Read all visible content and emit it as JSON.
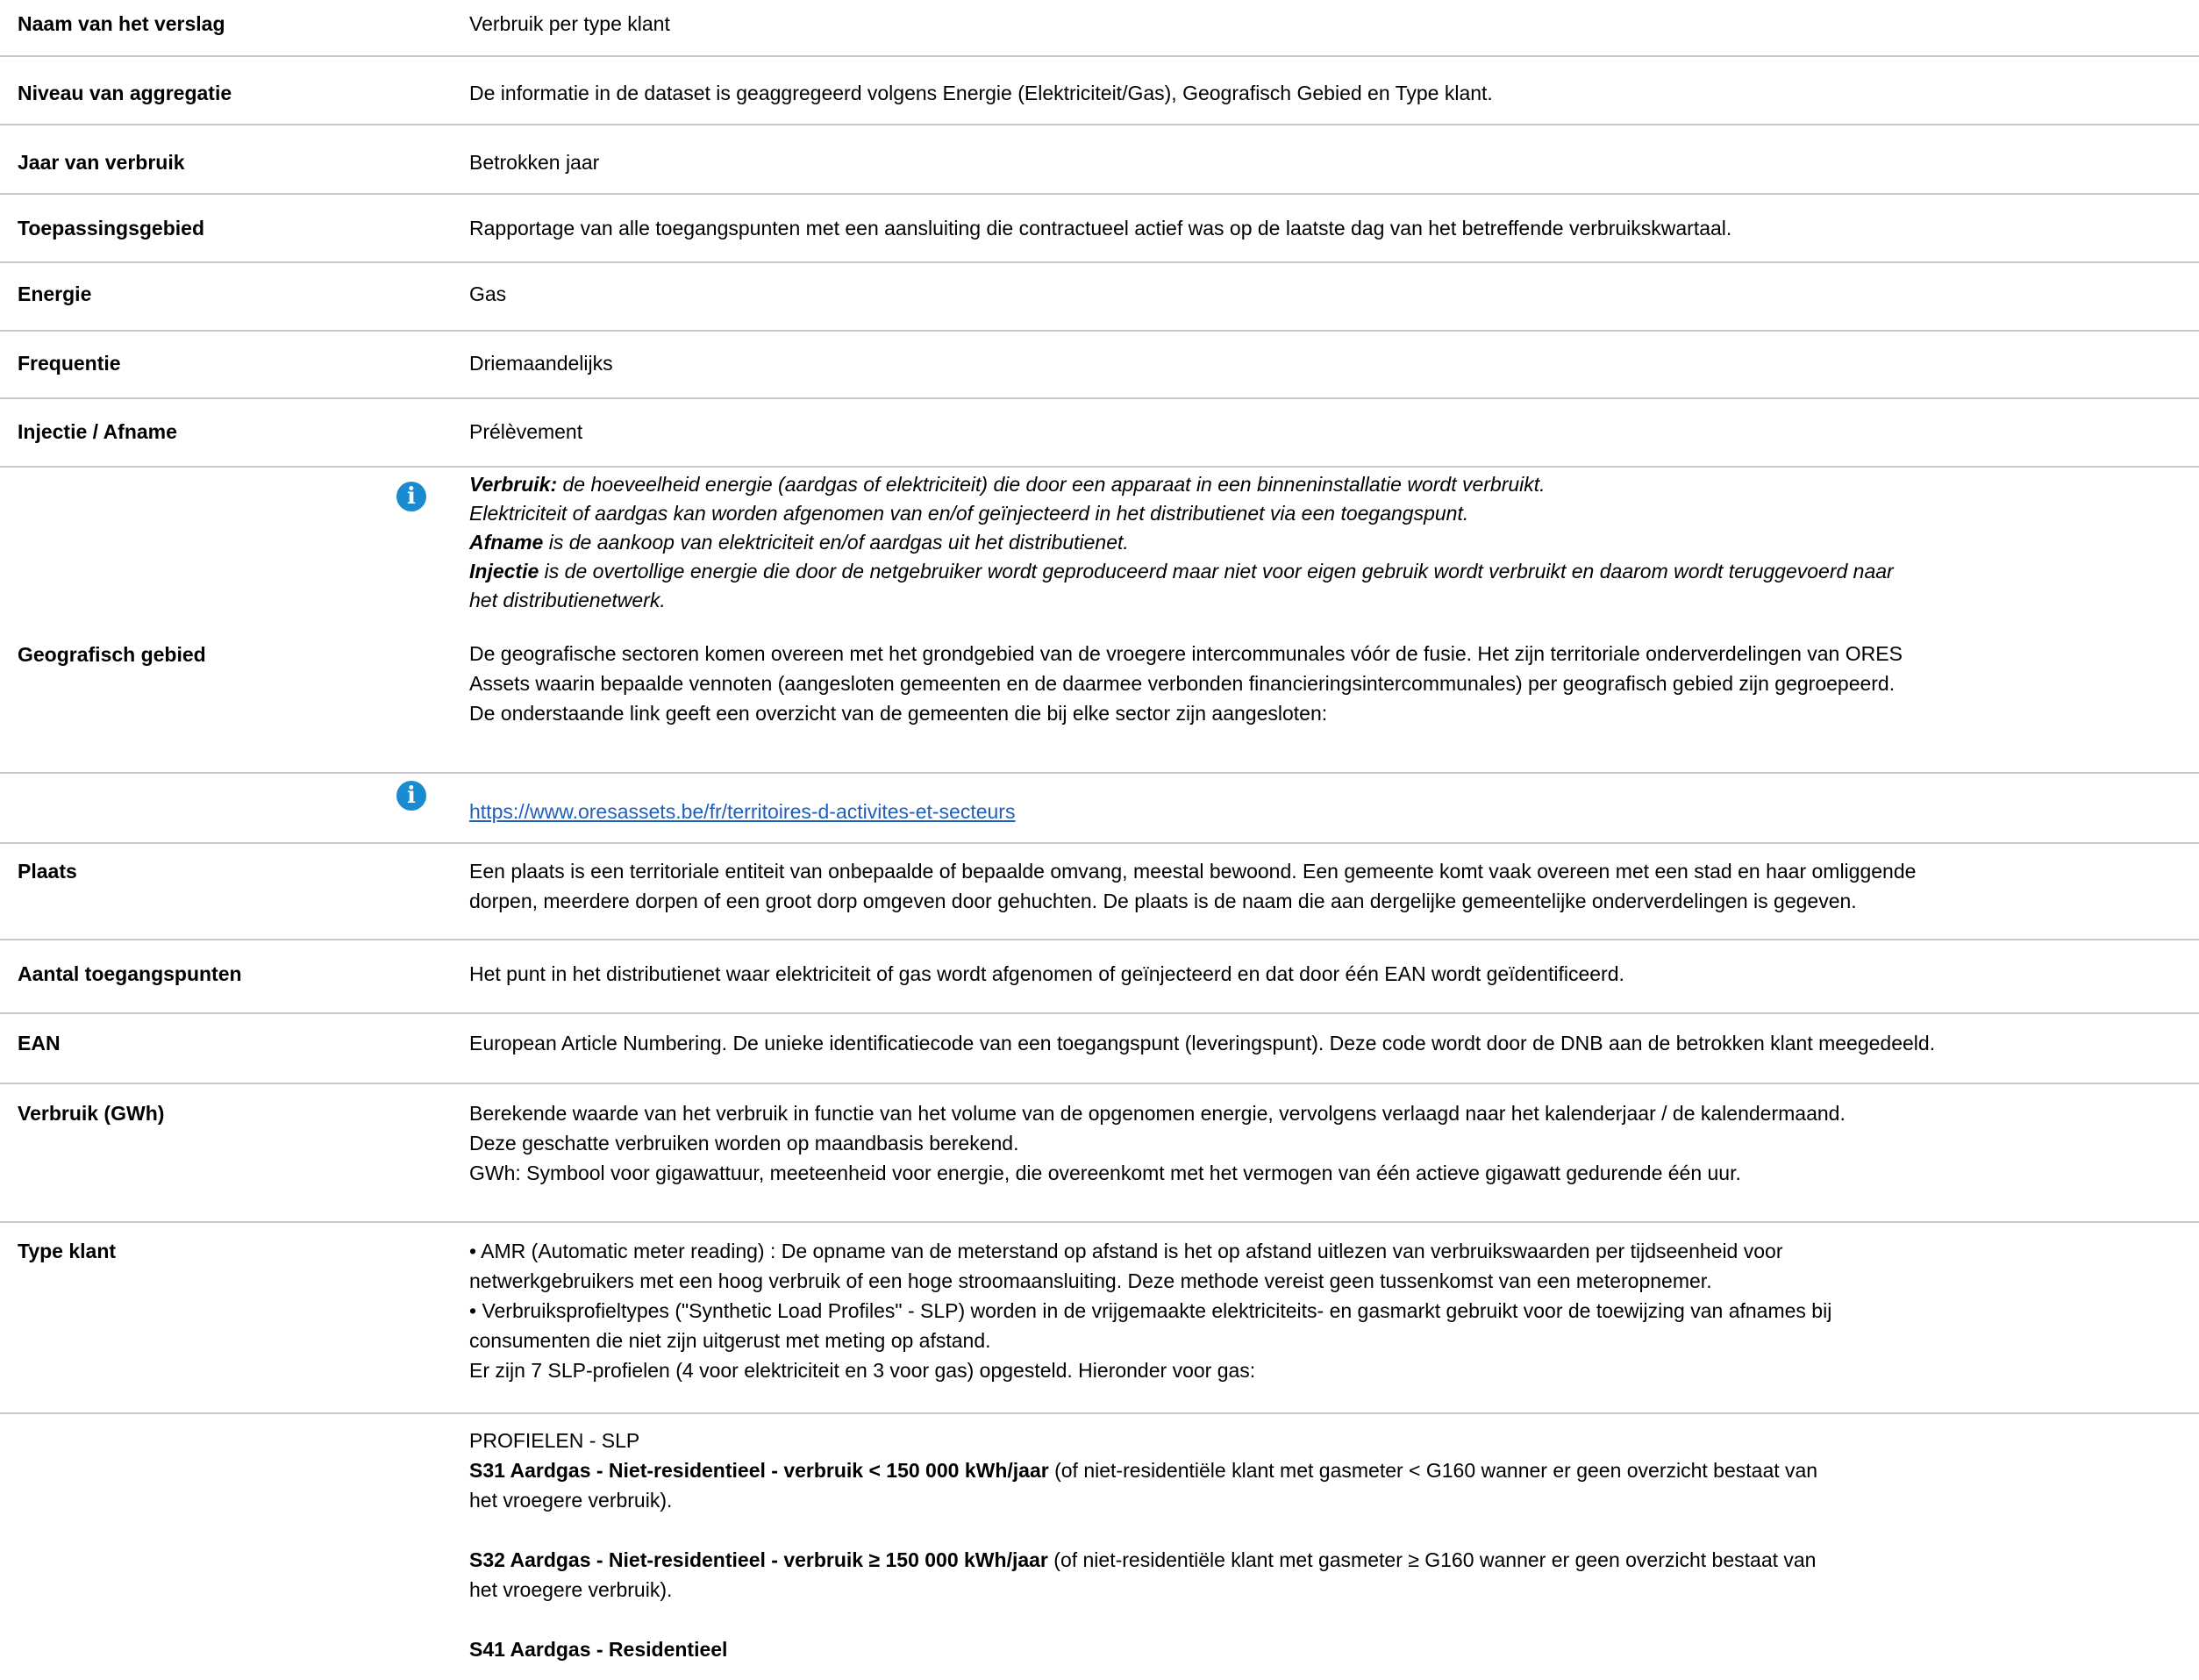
{
  "rows": {
    "naam": {
      "label": "Naam van het verslag",
      "value": "Verbruik per type klant"
    },
    "niveau": {
      "label": "Niveau van aggregatie",
      "value": "De informatie in de dataset is geaggregeerd volgens Energie (Elektriciteit/Gas), Geografisch Gebied en Type klant."
    },
    "jaar": {
      "label": "Jaar van verbruik",
      "value": "Betrokken jaar"
    },
    "toepassing": {
      "label": "Toepassingsgebied",
      "value": "Rapportage van alle toegangspunten met een aansluiting die contractueel actief was op de laatste dag van het betreffende verbruikskwartaal."
    },
    "energie": {
      "label": "Energie",
      "value": "Gas"
    },
    "frequentie": {
      "label": "Frequentie",
      "value": "Driemaandelijks"
    },
    "injectie": {
      "label": "Injectie / Afname",
      "value": "Prélèvement"
    }
  },
  "info_block": {
    "line1_bold": "Verbruik:",
    "line1_rest": "  de hoeveelheid energie (aardgas of elektriciteit) die door een apparaat in een binneninstallatie wordt verbruikt.",
    "line2": "Elektriciteit of aardgas kan worden afgenomen van en/of geïnjecteerd in het distributienet via een toegangspunt.",
    "line3_bold": "Afname",
    "line3_rest": " is de aankoop van elektriciteit en/of aardgas uit het distributienet.",
    "line4_bold": "Injectie",
    "line4_rest": "  is de overtollige energie die door de netgebruiker wordt geproduceerd maar niet voor eigen gebruik wordt verbruikt en daarom wordt teruggevoerd naar",
    "line5": "het distributienetwerk."
  },
  "geografisch": {
    "label": "Geografisch gebied",
    "lines": [
      "De geografische sectoren komen overeen met het grondgebied van de vroegere intercommunales vóór de fusie. Het zijn territoriale onderverdelingen van ORES",
      "Assets waarin bepaalde vennoten (aangesloten gemeenten en de daarmee verbonden financieringsintercommunales) per geografisch gebied zijn gegroepeerd.",
      "De onderstaande link geeft een overzicht van de gemeenten die bij elke sector zijn aangesloten:"
    ],
    "link": "https://www.oresassets.be/fr/territoires-d-activites-et-secteurs"
  },
  "plaats": {
    "label": "Plaats",
    "lines": [
      "Een plaats is een territoriale entiteit van onbepaalde of bepaalde omvang, meestal bewoond. Een gemeente komt vaak overeen met een stad en haar omliggende",
      "dorpen, meerdere dorpen of een groot dorp omgeven door gehuchten. De plaats is de naam die aan dergelijke gemeentelijke onderverdelingen is gegeven."
    ]
  },
  "aantal": {
    "label": "Aantal toegangspunten",
    "value": "Het punt in het distributienet waar elektriciteit of gas wordt afgenomen of geïnjecteerd en dat door één EAN wordt geïdentificeerd."
  },
  "ean": {
    "label": "EAN",
    "value": "European Article Numbering. De unieke identificatiecode van een toegangspunt (leveringspunt). Deze code wordt door de DNB aan de betrokken klant meegedeeld."
  },
  "verbruik": {
    "label": "Verbruik (GWh)",
    "lines": [
      "Berekende waarde van het verbruik in functie van het volume van de opgenomen energie, vervolgens verlaagd naar het kalenderjaar / de kalendermaand.",
      "Deze geschatte verbruiken worden op maandbasis berekend.",
      "GWh: Symbool voor gigawattuur, meeteenheid voor energie, die overeenkomt met het vermogen van één actieve gigawatt gedurende één uur."
    ]
  },
  "type_klant": {
    "label": "Type klant",
    "lines": [
      "• AMR (Automatic meter reading) : De opname van de meterstand op afstand is het op afstand uitlezen van verbruikswaarden per tijdseenheid voor",
      "netwerkgebruikers met een hoog verbruik of een hoge stroomaansluiting. Deze methode vereist geen tussenkomst van een meteropnemer.",
      "• Verbruiksprofieltypes (\"Synthetic Load Profiles\" - SLP) worden in de vrijgemaakte elektriciteits- en gasmarkt gebruikt voor de toewijzing van afnames bij",
      "consumenten die niet zijn uitgerust met meting op afstand.",
      "Er zijn 7 SLP-profielen (4 voor elektriciteit en 3 voor gas) opgesteld. Hieronder voor gas:"
    ]
  },
  "profielen": {
    "heading": "PROFIELEN - SLP",
    "s31_bold": "S31 Aardgas - Niet-residentieel - verbruik < 150 000 kWh/jaar",
    "s31_rest": " (of niet-residentiële klant met gasmeter < G160 wanner er geen overzicht bestaat van",
    "s31_line2": "het vroegere verbruik).",
    "s32_bold": "S32 Aardgas - Niet-residentieel - verbruik ≥ 150 000 kWh/jaar",
    "s32_rest": " (of niet-residentiële klant met gasmeter ≥ G160 wanner er geen overzicht bestaat van",
    "s32_line2": "het vroegere verbruik).",
    "s41_bold": "S41 Aardgas - Residentieel"
  }
}
